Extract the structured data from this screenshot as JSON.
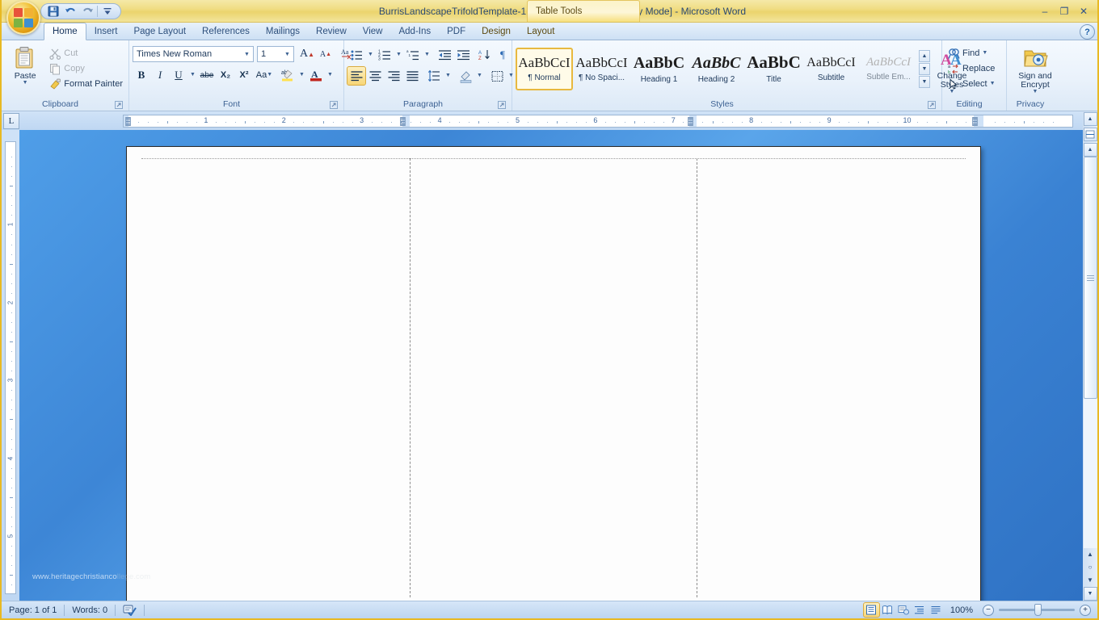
{
  "window": {
    "title": "BurrisLandscapeTrifoldTemplate-1 (Read-Only) [Compatibility Mode] - Microsoft Word",
    "contextual_tools_label": "Table Tools",
    "minimize": "–",
    "restore": "❐",
    "close": "✕",
    "help": "?"
  },
  "quick_access": {
    "save": "save-icon",
    "undo": "undo-icon",
    "redo": "redo-icon",
    "customize": "customize-icon"
  },
  "tabs": [
    {
      "label": "Home",
      "active": true,
      "contextual": false
    },
    {
      "label": "Insert",
      "active": false,
      "contextual": false
    },
    {
      "label": "Page Layout",
      "active": false,
      "contextual": false
    },
    {
      "label": "References",
      "active": false,
      "contextual": false
    },
    {
      "label": "Mailings",
      "active": false,
      "contextual": false
    },
    {
      "label": "Review",
      "active": false,
      "contextual": false
    },
    {
      "label": "View",
      "active": false,
      "contextual": false
    },
    {
      "label": "Add-Ins",
      "active": false,
      "contextual": false
    },
    {
      "label": "PDF",
      "active": false,
      "contextual": false
    },
    {
      "label": "Design",
      "active": false,
      "contextual": true
    },
    {
      "label": "Layout",
      "active": false,
      "contextual": true
    }
  ],
  "ribbon": {
    "clipboard": {
      "group_label": "Clipboard",
      "paste": "Paste",
      "cut": "Cut",
      "copy": "Copy",
      "format_painter": "Format Painter"
    },
    "font": {
      "group_label": "Font",
      "font_name": "Times New Roman",
      "font_size": "1",
      "grow_font": "grow-font-icon",
      "shrink_font": "shrink-font-icon",
      "clear_formatting": "clear-formatting-icon",
      "bold": "B",
      "italic": "I",
      "underline": "U",
      "strikethrough": "abe",
      "subscript": "X₂",
      "superscript": "X²",
      "change_case": "Aa",
      "highlight": "text-highlight-icon",
      "font_color": "A"
    },
    "paragraph": {
      "group_label": "Paragraph",
      "bullets": "bullets-icon",
      "numbering": "numbering-icon",
      "multilevel": "multilevel-list-icon",
      "decrease_indent": "decrease-indent-icon",
      "increase_indent": "increase-indent-icon",
      "sort": "sort-icon",
      "show_marks": "¶",
      "align_left": "align-left-icon",
      "align_center": "align-center-icon",
      "align_right": "align-right-icon",
      "justify": "justify-icon",
      "line_spacing": "line-spacing-icon",
      "shading": "shading-icon",
      "borders": "borders-icon"
    },
    "styles": {
      "group_label": "Styles",
      "items": [
        {
          "preview": "AaBbCcI",
          "name": "¶ Normal",
          "selected": true
        },
        {
          "preview": "AaBbCcI",
          "name": "¶ No Spaci...",
          "selected": false
        },
        {
          "preview": "AaBbC",
          "name": "Heading 1",
          "selected": false
        },
        {
          "preview": "AaBbC",
          "name": "Heading 2",
          "selected": false
        },
        {
          "preview": "AaBbC",
          "name": "Title",
          "selected": false
        },
        {
          "preview": "AaBbCcI",
          "name": "Subtitle",
          "selected": false
        },
        {
          "preview": "AaBbCcI",
          "name": "Subtle Em...",
          "selected": false
        }
      ],
      "change_styles": "Change\nStyles"
    },
    "editing": {
      "group_label": "Editing",
      "find": "Find",
      "replace": "Replace",
      "select": "Select"
    },
    "privacy": {
      "group_label": "Privacy",
      "sign_and_encrypt": "Sign and Encrypt"
    }
  },
  "ruler": {
    "tab_selector": "L",
    "h_numbers": [
      "1",
      "2",
      "3",
      "4",
      "5",
      "6",
      "7",
      "8",
      "9",
      "10"
    ],
    "v_numbers": [
      "1",
      "2",
      "3",
      "4",
      "5"
    ]
  },
  "document": {
    "watermark_visible": "www.heritagechristianco",
    "watermark_faded": "llege.com",
    "columns": 3
  },
  "status": {
    "page": "Page: 1 of 1",
    "words": "Words: 0",
    "proofing": "proofing-errors-icon",
    "views": [
      {
        "name": "print-layout-view",
        "on": true
      },
      {
        "name": "full-screen-reading-view",
        "on": false
      },
      {
        "name": "web-layout-view",
        "on": false
      },
      {
        "name": "outline-view",
        "on": false
      },
      {
        "name": "draft-view",
        "on": false
      }
    ],
    "zoom": "100%",
    "zoom_out": "−",
    "zoom_in": "+"
  }
}
